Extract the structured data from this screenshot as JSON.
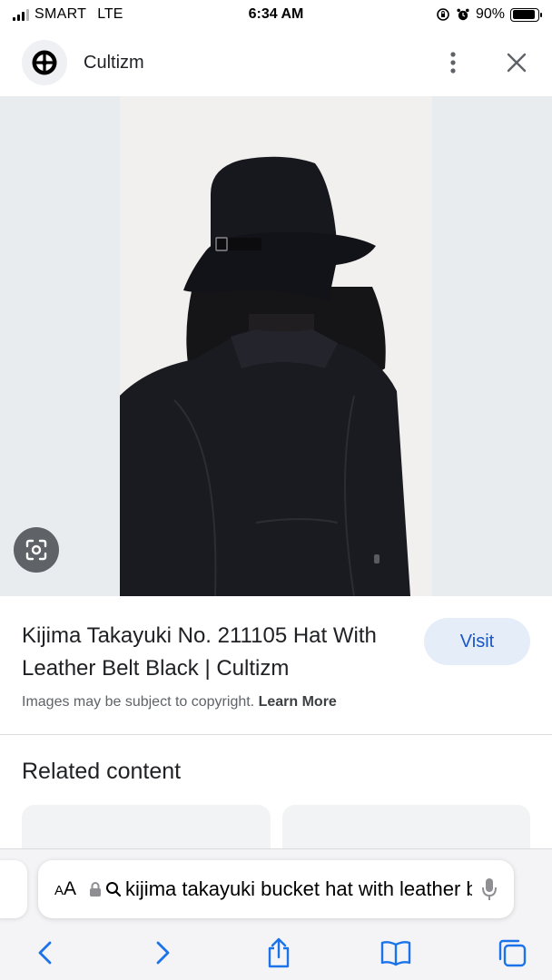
{
  "status_bar": {
    "carrier": "SMART",
    "network": "LTE",
    "time": "6:34 AM",
    "battery": "90%",
    "battery_level": 0.9
  },
  "header": {
    "site_name": "Cultizm"
  },
  "result": {
    "title": "Kijima Takayuki No. 211105 Hat With Leather Belt Black | Cultizm",
    "visit_label": "Visit",
    "copyright_text": "Images may be subject to copyright.",
    "learn_more": "Learn More"
  },
  "related": {
    "heading": "Related content"
  },
  "browser": {
    "aa_label_large": "A",
    "aa_label_small": "A",
    "search_text": "kijima takayuki bucket hat with leather belt"
  },
  "icons": {
    "header": [
      "site-logo-icon",
      "more-vert-icon",
      "close-icon"
    ],
    "image": [
      "lens-icon"
    ],
    "toolbar": [
      "back-icon",
      "forward-icon",
      "share-icon",
      "bookmarks-icon",
      "tabs-icon"
    ]
  },
  "colors": {
    "accent": "#1a56c4",
    "visit_bg": "#e5edf9",
    "toolbar_icons": "#1a73e8"
  }
}
